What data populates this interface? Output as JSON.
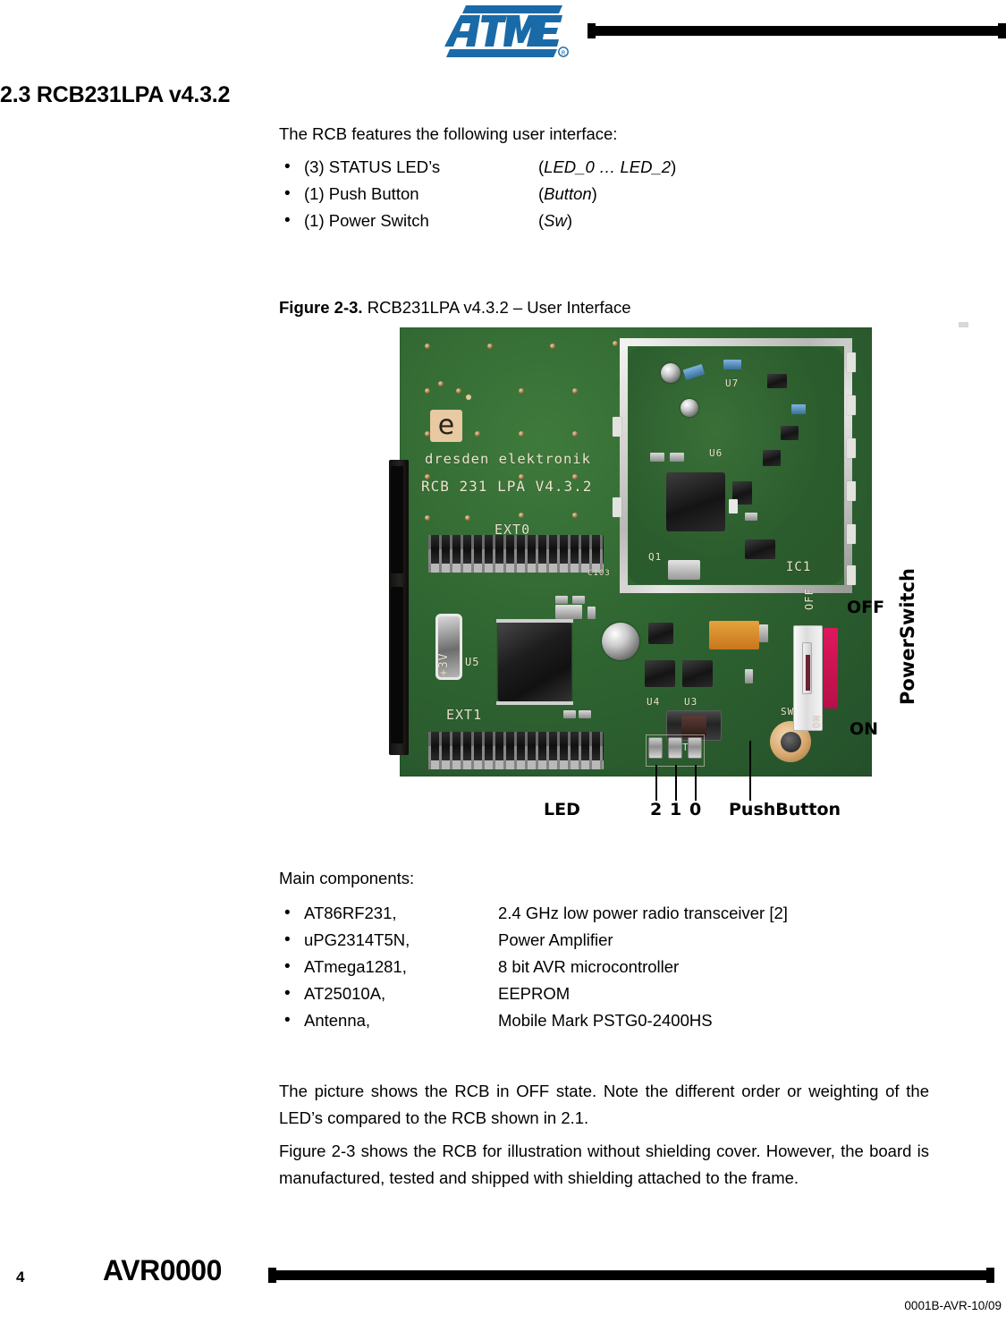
{
  "header": {
    "logo_text": "ATMEL",
    "logo_registered": "®",
    "logo_color": "#1a6aa8"
  },
  "heading": "2.3 RCB231LPA v4.3.2",
  "intro": "The RCB features the following user interface:",
  "ui_list": [
    {
      "bullet": "•",
      "label": "(3) STATUS LED’s",
      "code_open": "(",
      "code": "LED_0 … LED_2",
      "code_close": ")"
    },
    {
      "bullet": "•",
      "label": "(1) Push Button",
      "code_open": "(",
      "code": "Button",
      "code_close": ")"
    },
    {
      "bullet": "•",
      "label": "(1) Power Switch",
      "code_open": "(",
      "code": "Sw",
      "code_close": ")"
    }
  ],
  "figure": {
    "caption_label": "Figure 2-3.",
    "caption_text": " RCB231LPA v4.3.2 – User Interface",
    "board": {
      "silkscreen": {
        "logo_glyph": "e",
        "brand": "dresden elektronik",
        "part": "RCB 231 LPA V4.3.2",
        "ext0": "EXT0",
        "ext1": "EXT1",
        "u5": "U5",
        "u4": "U4",
        "u3": "U3",
        "u6": "U6",
        "u7": "U7",
        "q1": "Q1",
        "ic1": "IC1",
        "t1": "T1",
        "sw": "SW",
        "off": "OFF",
        "on": "ON",
        "plus3v": "+3V",
        "c103": "C103"
      },
      "colors": {
        "pcb_green": "#2f6531",
        "shield_metal": "#d8d8d5",
        "switch_red": "#e0175c",
        "pad_copper": "#d8a86d"
      }
    },
    "annotations": {
      "led_label": "LED",
      "led_numbers": [
        "2",
        "1",
        "0"
      ],
      "push_button": "PushButton",
      "off": "OFF",
      "on": "ON",
      "power_switch": "PowerSwitch"
    }
  },
  "components_lead": "Main components:",
  "components": [
    {
      "bullet": "•",
      "part": "AT86RF231,",
      "desc": "2.4 GHz low power radio transceiver [2]"
    },
    {
      "bullet": "•",
      "part": "uPG2314T5N,",
      "desc": "Power Amplifier"
    },
    {
      "bullet": "•",
      "part": "ATmega1281,",
      "desc": "8 bit AVR microcontroller"
    },
    {
      "bullet": "•",
      "part": "AT25010A,",
      "desc": "EEPROM"
    },
    {
      "bullet": "•",
      "part": "Antenna,",
      "desc": "Mobile Mark PSTG0-2400HS"
    }
  ],
  "paragraphs": {
    "p1": "The picture shows the RCB in OFF state. Note the different order or weighting of the LED’s compared to the RCB shown in 2.1.",
    "p2": "Figure 2-3 shows the RCB for illustration without shielding cover. However, the board is manufactured, tested and shipped with shielding attached to the frame."
  },
  "footer": {
    "page_number": "4",
    "doc_name": "AVR0000",
    "doc_number": "0001B-AVR-10/09"
  }
}
